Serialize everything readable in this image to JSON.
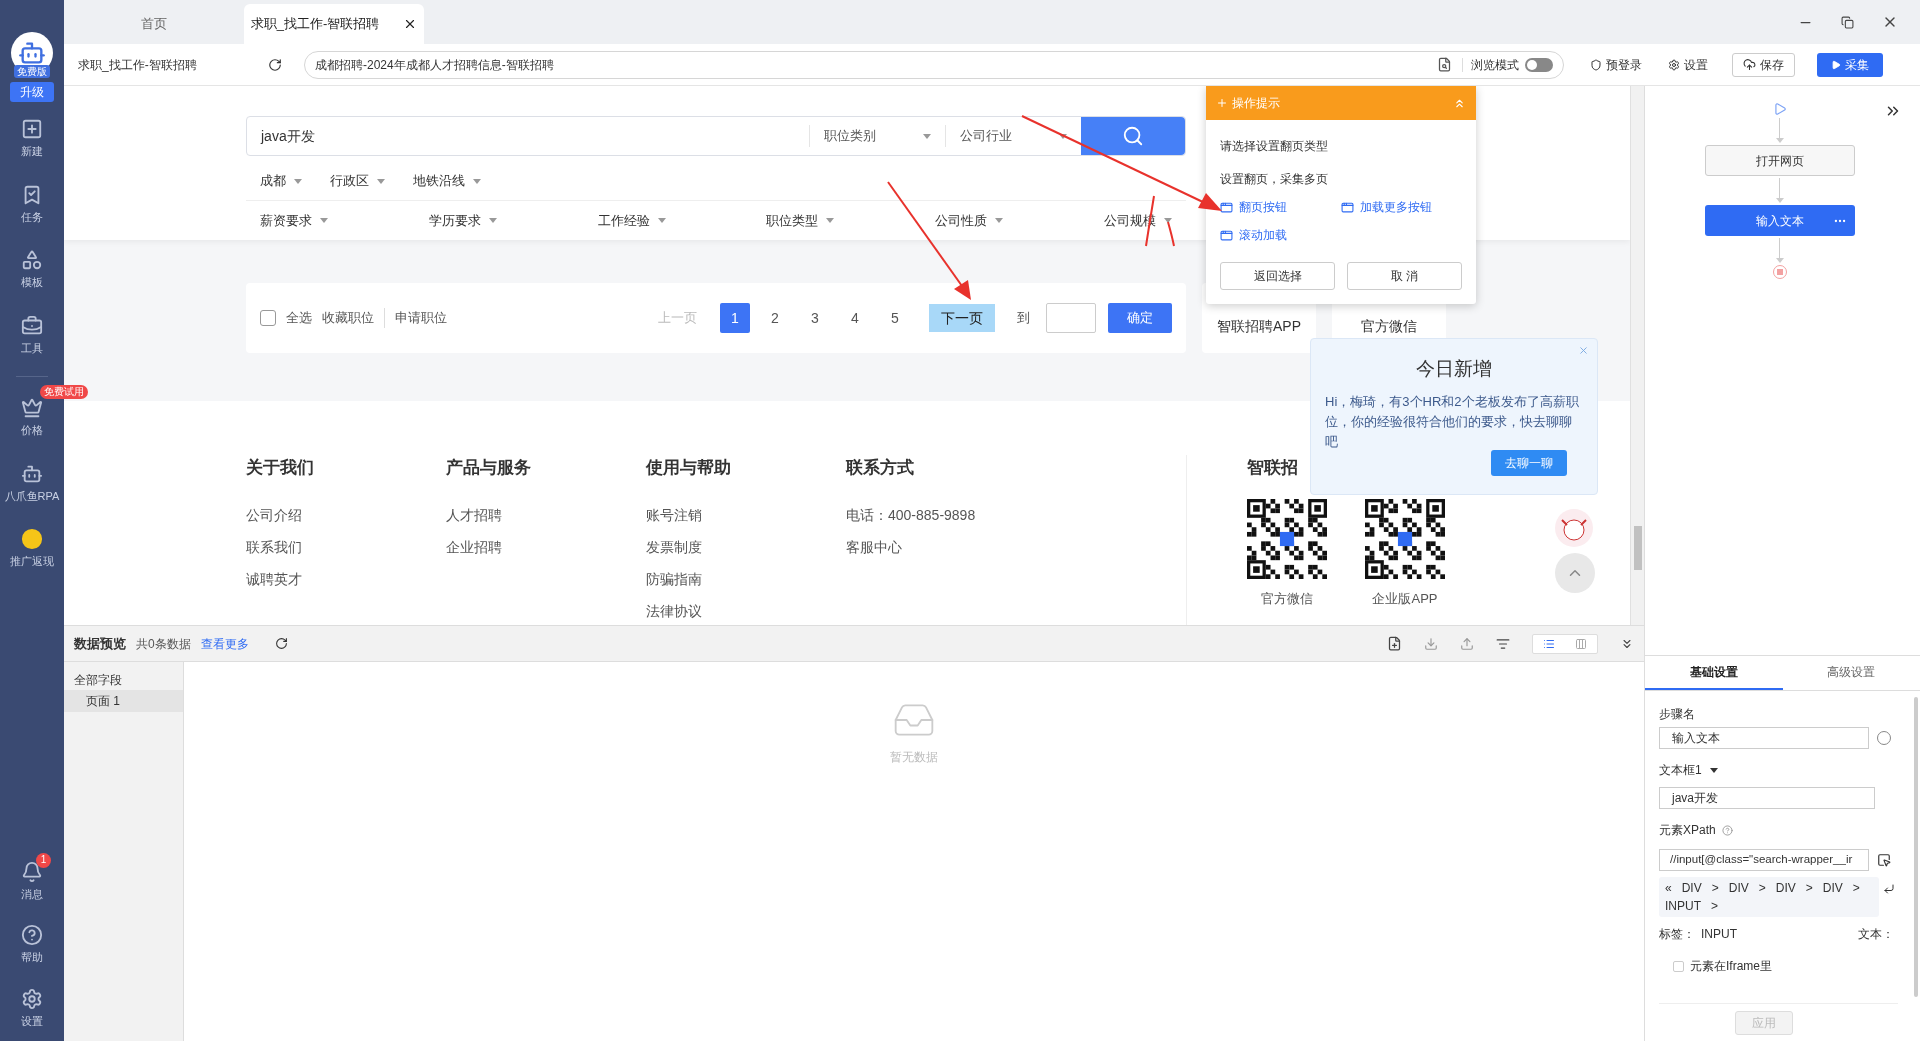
{
  "sidebar": {
    "badge": "免费版",
    "upgrade": "升级",
    "items": [
      {
        "label": "新建"
      },
      {
        "label": "任务"
      },
      {
        "label": "模板"
      },
      {
        "label": "工具"
      }
    ],
    "items2": [
      {
        "label": "价格",
        "badge": "免费试用"
      },
      {
        "label": "八爪鱼RPA"
      },
      {
        "label": "推广返现"
      }
    ],
    "bottom_items": [
      {
        "label": "消息",
        "badge": "1"
      },
      {
        "label": "帮助"
      },
      {
        "label": "设置"
      }
    ]
  },
  "browser_tabs": [
    {
      "label": "首页",
      "selected": false
    },
    {
      "label": "求职_找工作-智联招聘",
      "selected": true
    }
  ],
  "toolbar": {
    "page_title": "求职_找工作-智联招聘",
    "url": "成都招聘-2024年成都人才招聘信息-智联招聘",
    "mode_label": "浏览模式",
    "mode_on": false,
    "prelogin": "预登录",
    "settings": "设置",
    "save": "保存",
    "collect": "采集"
  },
  "page": {
    "search": {
      "value": "java开发",
      "dropdowns": [
        "职位类别",
        "公司行业"
      ]
    },
    "filters_row1": [
      "成都",
      "行政区",
      "地铁沿线"
    ],
    "filters_row2": [
      "薪资要求",
      "学历要求",
      "工作经验",
      "职位类型",
      "公司性质",
      "公司规模"
    ],
    "pagination": {
      "select_all": "全选",
      "checked": false,
      "actions": [
        "收藏职位",
        "申请职位"
      ],
      "prev": "上一页",
      "pages": [
        {
          "label": "1",
          "selected": true
        },
        {
          "label": "2",
          "selected": false
        },
        {
          "label": "3",
          "selected": false
        },
        {
          "label": "4",
          "selected": false
        },
        {
          "label": "5",
          "selected": false
        }
      ],
      "next": {
        "label": "下一页",
        "highlighted": true
      },
      "goto": "到",
      "confirm": "确定"
    },
    "side_cards": [
      "智联招聘APP",
      "官方微信"
    ],
    "footer": {
      "columns": [
        {
          "heading": "关于我们",
          "links": [
            "公司介绍",
            "联系我们",
            "诚聘英才"
          ]
        },
        {
          "heading": "产品与服务",
          "links": [
            "人才招聘",
            "企业招聘"
          ]
        },
        {
          "heading": "使用与帮助",
          "links": [
            "账号注销",
            "发票制度",
            "防骗指南",
            "法律协议"
          ]
        },
        {
          "heading": "联系方式",
          "links": [
            "电话：400-885-9898",
            "客服中心"
          ]
        }
      ],
      "brand": "智联招",
      "qr": [
        "官方微信",
        "企业版APP"
      ]
    }
  },
  "tip_popup": {
    "title": "操作提示",
    "lines": [
      "请选择设置翻页类型",
      "设置翻页，采集多页"
    ],
    "options": [
      "翻页按钮",
      "加载更多按钮",
      "滚动加载"
    ],
    "buttons": [
      "返回选择",
      "取 消"
    ]
  },
  "notification": {
    "title": "今日新增",
    "text": "Hi，梅琦，有3个HR和2个老板发布了高薪职位，你的经验很符合他们的要求，快去聊聊吧",
    "button": "去聊一聊"
  },
  "data_preview": {
    "title": "数据预览",
    "count": "共0条数据",
    "more": "查看更多",
    "fields_header": "全部字段",
    "fields": [
      {
        "label": "页面 1",
        "selected": true
      }
    ],
    "empty": "暂无数据",
    "view_modes": [
      {
        "kind": "list",
        "selected": true
      },
      {
        "kind": "columns",
        "selected": false
      }
    ]
  },
  "flow": {
    "steps": [
      {
        "label": "打开网页",
        "selected": false
      },
      {
        "label": "输入文本",
        "selected": true
      }
    ]
  },
  "settings_panel": {
    "tabs": [
      {
        "label": "基础设置",
        "selected": true
      },
      {
        "label": "高级设置",
        "selected": false
      }
    ],
    "step_name_label": "步骤名",
    "step_name": "输入文本",
    "textbox_label": "文本框1",
    "textbox_value": "java开发",
    "xpath_label": "元素XPath",
    "xpath_value": "//input[@class=\"search-wrapper__ir",
    "path_back": "«",
    "path": [
      "DIV",
      "DIV",
      "DIV",
      "DIV",
      "INPUT"
    ],
    "path_separator": ">",
    "tag_label": "标签：",
    "tag_value": "INPUT",
    "text_label": "文本：",
    "iframe_label": "元素在Iframe里",
    "iframe_checked": false,
    "apply": "应用"
  }
}
